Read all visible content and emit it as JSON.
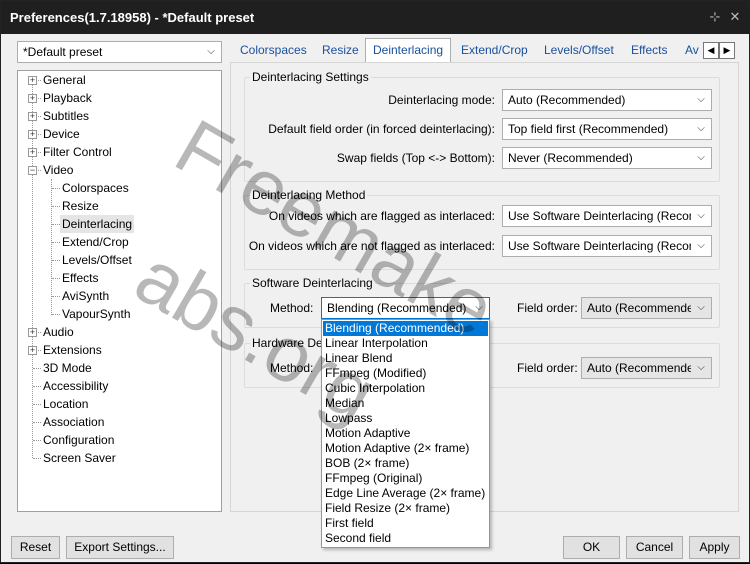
{
  "window": {
    "title": "Preferences(1.7.18958) - *Default preset",
    "pin_icon": "pin-icon",
    "close_icon": "close-icon"
  },
  "preset": {
    "value": "*Default preset"
  },
  "tree": {
    "items": [
      {
        "label": "General",
        "expander": "+"
      },
      {
        "label": "Playback",
        "expander": "+"
      },
      {
        "label": "Subtitles",
        "expander": "+"
      },
      {
        "label": "Device",
        "expander": "+"
      },
      {
        "label": "Filter Control",
        "expander": "+"
      },
      {
        "label": "Video",
        "expander": "−"
      },
      {
        "label": "Colorspaces"
      },
      {
        "label": "Resize"
      },
      {
        "label": "Deinterlacing"
      },
      {
        "label": "Extend/Crop"
      },
      {
        "label": "Levels/Offset"
      },
      {
        "label": "Effects"
      },
      {
        "label": "AviSynth"
      },
      {
        "label": "VapourSynth"
      },
      {
        "label": "Audio",
        "expander": "+"
      },
      {
        "label": "Extensions",
        "expander": "+"
      },
      {
        "label": "3D Mode"
      },
      {
        "label": "Accessibility"
      },
      {
        "label": "Location"
      },
      {
        "label": "Association"
      },
      {
        "label": "Configuration"
      },
      {
        "label": "Screen Saver"
      }
    ]
  },
  "tabs": [
    {
      "label": "Colorspaces"
    },
    {
      "label": "Resize"
    },
    {
      "label": "Deinterlacing"
    },
    {
      "label": "Extend/Crop"
    },
    {
      "label": "Levels/Offset"
    },
    {
      "label": "Effects"
    },
    {
      "label": "Av"
    }
  ],
  "tab_scroll": {
    "left": "◀",
    "right": "▶"
  },
  "deint_settings": {
    "title": "Deinterlacing Settings",
    "mode_label": "Deinterlacing mode:",
    "mode_value": "Auto (Recommended)",
    "field_order_label": "Default field order (in forced deinterlacing):",
    "field_order_value": "Top field first (Recommended)",
    "swap_label": "Swap fields (Top <-> Bottom):",
    "swap_value": "Never (Recommended)"
  },
  "deint_method": {
    "title": "Deinterlacing Method",
    "flagged_label": "On videos which are flagged as interlaced:",
    "flagged_value": "Use Software Deinterlacing (Recom",
    "not_flagged_label": "On videos which are not flagged as interlaced:",
    "not_flagged_value": "Use Software Deinterlacing (Recom"
  },
  "software_deint": {
    "title": "Software Deinterlacing",
    "method_label": "Method:",
    "method_value": "Blending (Recommended)",
    "field_order_label": "Field order:",
    "field_order_value": "Auto (Recommende"
  },
  "hardware_deint": {
    "title": "Hardware De",
    "method_label": "Method:",
    "field_order_label": "Field order:",
    "field_order_value": "Auto (Recommende"
  },
  "method_options": [
    "Blending (Recommended)",
    "Linear Interpolation",
    "Linear Blend",
    "FFmpeg (Modified)",
    "Cubic Interpolation",
    "Median",
    "Lowpass",
    "Motion Adaptive",
    "Motion Adaptive (2× frame)",
    "BOB (2× frame)",
    "FFmpeg (Original)",
    "Edge Line Average (2× frame)",
    "Field Resize (2× frame)",
    "First field",
    "Second field"
  ],
  "buttons": {
    "reset": "Reset",
    "export": "Export Settings...",
    "ok": "OK",
    "cancel": "Cancel",
    "apply": "Apply"
  },
  "watermark": {
    "line1": "Freemake",
    "line2": "abs.org"
  },
  "colors": {
    "title_bg": "#1f1f1f",
    "tab_text": "#1a50a0",
    "selection": "#0078d7"
  }
}
